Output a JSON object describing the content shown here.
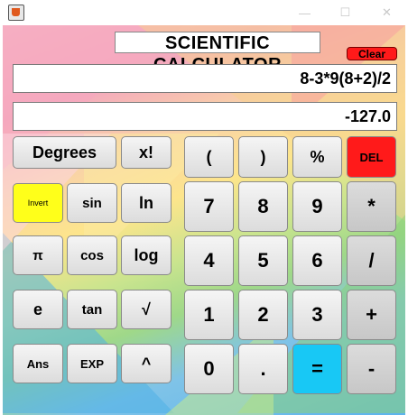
{
  "window": {
    "minimize": "—",
    "maximize": "☐",
    "close": "✕"
  },
  "app": {
    "title": "SCIENTIFIC CALCULATOR",
    "clear_label": "Clear"
  },
  "display": {
    "expression": "8-3*9(8+2)/2",
    "result": "-127.0"
  },
  "left_buttons": {
    "degrees": "Degrees",
    "factorial": "x!",
    "invert": "Invert",
    "sin": "sin",
    "ln": "ln",
    "pi": "π",
    "cos": "cos",
    "log": "log",
    "e": "e",
    "tan": "tan",
    "sqrt": "√",
    "ans": "Ans",
    "exp": "EXP",
    "power": "^"
  },
  "right_buttons": {
    "open_paren": "(",
    "close_paren": ")",
    "percent": "%",
    "del": "DEL",
    "seven": "7",
    "eight": "8",
    "nine": "9",
    "multiply": "*",
    "four": "4",
    "five": "5",
    "six": "6",
    "divide": "/",
    "one": "1",
    "two": "2",
    "three": "3",
    "plus": "+",
    "zero": "0",
    "dot": ".",
    "equals": "=",
    "minus": "-"
  },
  "colors": {
    "invert_bg": "#ffff1a",
    "del_bg": "#ff1a1a",
    "clear_bg": "#ff1a1a",
    "equals_bg": "#18c8f5"
  }
}
